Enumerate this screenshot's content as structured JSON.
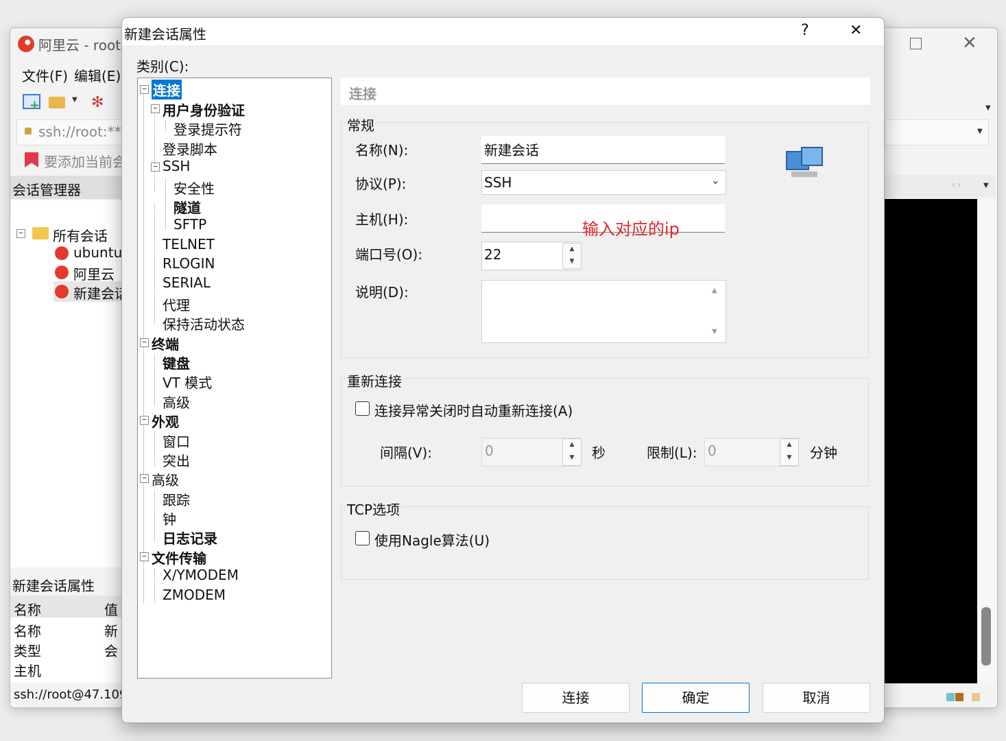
{
  "bg_window": {
    "title": "阿里云 - root",
    "menu": [
      "文件(F)",
      "编辑(E)"
    ],
    "address": "ssh://root:***",
    "add_prompt": "要添加当前会",
    "session_manager": "会话管理器",
    "tree_root": "所有会话",
    "sessions": [
      "ubuntu",
      "阿里云",
      "新建会话"
    ],
    "props_title": "新建会话属性",
    "props_cols": [
      "名称",
      "值"
    ],
    "props_rows": [
      [
        "名称",
        "新"
      ],
      [
        "类型",
        "会"
      ],
      [
        "主机",
        ""
      ]
    ],
    "status": "ssh://root@47.109."
  },
  "dialog": {
    "title": "新建会话属性",
    "help": "?",
    "close": "✕",
    "category_label": "类别(C):",
    "tree": [
      {
        "label": "连接",
        "bold": true,
        "selected": true
      },
      {
        "label": "用户身份验证",
        "bold": true
      },
      {
        "label": "登录提示符"
      },
      {
        "label": "登录脚本"
      },
      {
        "label": "SSH"
      },
      {
        "label": "安全性"
      },
      {
        "label": "隧道",
        "bold": true
      },
      {
        "label": "SFTP"
      },
      {
        "label": "TELNET"
      },
      {
        "label": "RLOGIN"
      },
      {
        "label": "SERIAL"
      },
      {
        "label": "代理"
      },
      {
        "label": "保持活动状态"
      },
      {
        "label": "终端",
        "bold": true
      },
      {
        "label": "键盘",
        "bold": true
      },
      {
        "label": "VT 模式"
      },
      {
        "label": "高级"
      },
      {
        "label": "外观",
        "bold": true
      },
      {
        "label": "窗口"
      },
      {
        "label": "突出"
      },
      {
        "label": "高级"
      },
      {
        "label": "跟踪"
      },
      {
        "label": "钟"
      },
      {
        "label": "日志记录",
        "bold": true
      },
      {
        "label": "文件传输",
        "bold": true
      },
      {
        "label": "X/YMODEM"
      },
      {
        "label": "ZMODEM"
      }
    ],
    "panel_header": "连接",
    "general": {
      "legend": "常规",
      "name_label": "名称(N):",
      "name_value": "新建会话",
      "protocol_label": "协议(P):",
      "protocol_value": "SSH",
      "host_label": "主机(H):",
      "host_value": "",
      "host_annotation": "输入对应的ip",
      "port_label": "端口号(O):",
      "port_value": "22",
      "desc_label": "说明(D):",
      "desc_value": ""
    },
    "reconnect": {
      "legend": "重新连接",
      "auto_label": "连接异常关闭时自动重新连接(A)",
      "interval_label": "间隔(V):",
      "interval_value": "0",
      "sec_unit": "秒",
      "limit_label": "限制(L):",
      "limit_value": "0",
      "min_unit": "分钟"
    },
    "tcp": {
      "legend": "TCP选项",
      "nagle_label": "使用Nagle算法(U)"
    },
    "buttons": {
      "connect": "连接",
      "ok": "确定",
      "cancel": "取消"
    }
  },
  "colors": {
    "selected_bg": "#0078d7",
    "annotation": "#e0252b",
    "terminal_bg": "#000000"
  }
}
